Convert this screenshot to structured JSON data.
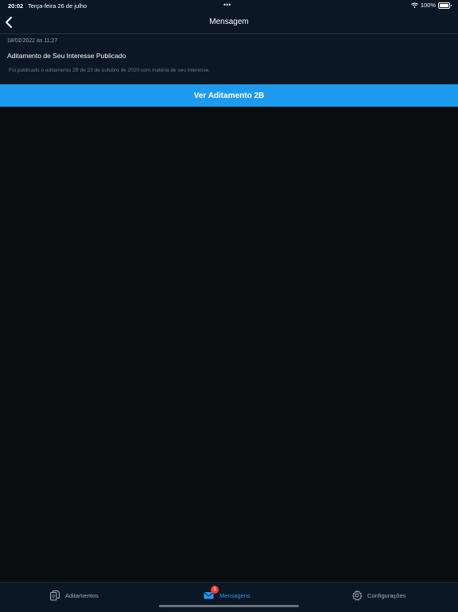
{
  "status_bar": {
    "time": "20:02",
    "date": "Terça-feira 26 de julho",
    "dots": "•••",
    "battery_percent": "100%",
    "icons": [
      "wifi-icon",
      "battery-icon"
    ]
  },
  "nav": {
    "title": "Mensagem",
    "back_icon": "chevron-left-icon"
  },
  "message": {
    "date": "18/02/2022 às 11:27",
    "title": "Aditamento de Seu Interesse Publicado",
    "body": "Foi publicado o aditamento 2B de 23 de outubro de 2020 com matéria de seu interesse."
  },
  "action": {
    "label": "Ver Aditamento 2B"
  },
  "tab_bar": {
    "tabs": [
      {
        "label": "Aditamentos",
        "icon": "documents-icon"
      },
      {
        "label": "Mensagens",
        "icon": "mail-icon",
        "badge": "1",
        "active": true
      },
      {
        "label": "Configurações",
        "icon": "gear-icon"
      }
    ]
  },
  "colors": {
    "accent": "#1e9bf0",
    "background": "#0b0c0d",
    "bar": "#0b1724",
    "badge": "#ff3b30"
  }
}
